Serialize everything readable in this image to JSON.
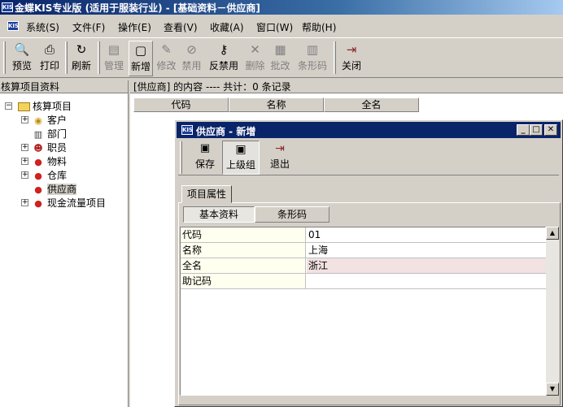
{
  "window": {
    "title": "金蝶KIS专业版 (适用于服装行业) - [基础资料－供应商]"
  },
  "menu": [
    "系统(S)",
    "文件(F)",
    "操作(E)",
    "查看(V)",
    "收藏(A)",
    "窗口(W)",
    "帮助(H)"
  ],
  "toolbar": [
    {
      "label": "预览",
      "icon": "preview-icon",
      "glyph": "🔍",
      "enabled": true
    },
    {
      "label": "打印",
      "icon": "print-icon",
      "glyph": "⎙",
      "enabled": true
    },
    {
      "label": "刷新",
      "icon": "refresh-icon",
      "glyph": "↻",
      "enabled": true
    },
    {
      "label": "管理",
      "icon": "manage-icon",
      "glyph": "▤",
      "enabled": false
    },
    {
      "label": "新增",
      "icon": "new-icon",
      "glyph": "▢",
      "enabled": true
    },
    {
      "label": "修改",
      "icon": "edit-icon",
      "glyph": "✎",
      "enabled": false
    },
    {
      "label": "禁用",
      "icon": "disable-icon",
      "glyph": "⊘",
      "enabled": false
    },
    {
      "label": "反禁用",
      "icon": "enable-icon",
      "glyph": "⚷",
      "enabled": true
    },
    {
      "label": "删除",
      "icon": "delete-icon",
      "glyph": "✕",
      "enabled": false
    },
    {
      "label": "批改",
      "icon": "batch-edit-icon",
      "glyph": "▦",
      "enabled": false
    },
    {
      "label": "条形码",
      "icon": "barcode-icon",
      "glyph": "▥",
      "enabled": false
    },
    {
      "label": "关闭",
      "icon": "close-door-icon",
      "glyph": "⇥",
      "enabled": true
    }
  ],
  "left_panel": {
    "header": "核算项目资料",
    "tree": [
      {
        "label": "核算项目",
        "icon": "folder-icon",
        "glyph": "📁",
        "indent": 0,
        "expander": "−"
      },
      {
        "label": "客户",
        "icon": "customer-icon",
        "glyph": "◉",
        "indent": 1,
        "expander": "+"
      },
      {
        "label": "部门",
        "icon": "department-icon",
        "glyph": "▥",
        "indent": 1,
        "expander": ""
      },
      {
        "label": "职员",
        "icon": "staff-icon",
        "glyph": "☻",
        "indent": 1,
        "expander": "+"
      },
      {
        "label": "物料",
        "icon": "material-icon",
        "glyph": "●",
        "indent": 1,
        "expander": "+"
      },
      {
        "label": "仓库",
        "icon": "warehouse-icon",
        "glyph": "●",
        "indent": 1,
        "expander": "+"
      },
      {
        "label": "供应商",
        "icon": "supplier-icon",
        "glyph": "●",
        "indent": 1,
        "expander": "",
        "selected": true
      },
      {
        "label": "现金流量项目",
        "icon": "cashflow-icon",
        "glyph": "●",
        "indent": 1,
        "expander": "+"
      }
    ]
  },
  "right_panel": {
    "header": "[供应商] 的内容 ---- 共计：0 条记录",
    "columns": [
      "代码",
      "名称",
      "全名"
    ]
  },
  "dialog": {
    "title": "供应商 - 新增",
    "buttons": [
      {
        "label": "保存",
        "icon": "save-icon",
        "glyph": "💾"
      },
      {
        "label": "上级组",
        "icon": "parent-group-icon",
        "glyph": "▣"
      },
      {
        "label": "退出",
        "icon": "exit-icon",
        "glyph": "⇥"
      }
    ],
    "tab": "项目属性",
    "subtabs": [
      "基本资料",
      "条形码"
    ],
    "fields": [
      {
        "key": "代码",
        "value": "01"
      },
      {
        "key": "名称",
        "value": "上海"
      },
      {
        "key": "全名",
        "value": "浙江",
        "highlight": true
      },
      {
        "key": "助记码",
        "value": ""
      }
    ]
  },
  "colors": {
    "title_bar": "#0a246a",
    "face": "#d4d0c8",
    "row_highlight": "#f2e2e2"
  }
}
